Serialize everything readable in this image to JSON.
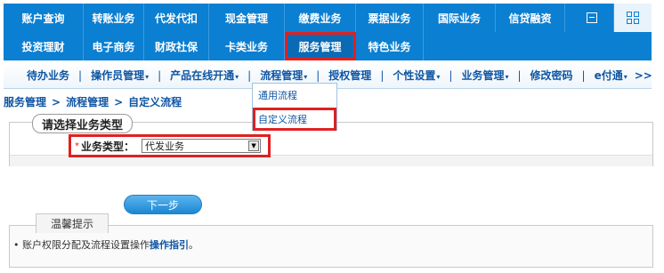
{
  "topnav": {
    "row1": [
      "账户查询",
      "转账业务",
      "代发代扣",
      "现金管理",
      "缴费业务",
      "票据业务",
      "国际业务",
      "信贷融资"
    ],
    "row2": [
      "投资理财",
      "电子商务",
      "财政社保",
      "卡类业务",
      "服务管理",
      "特色业务"
    ],
    "active": "服务管理"
  },
  "icons": {
    "collapse": "collapse-icon",
    "apps": "grid-icon",
    "dropdown_caret": "caret-down-icon"
  },
  "submenu": {
    "items": [
      "待办业务",
      "操作员管理",
      "产品在线开通",
      "流程管理",
      "授权管理",
      "个性设置",
      "业务管理",
      "修改密码",
      "e付通"
    ],
    "separator": "|",
    "caret": "▾",
    "more": ">>"
  },
  "dropdown": {
    "options": [
      "通用流程",
      "自定义流程"
    ],
    "highlighted": "自定义流程"
  },
  "breadcrumb": {
    "parts": [
      "服务管理",
      "流程管理",
      "自定义流程"
    ],
    "sep": ">"
  },
  "form": {
    "section_title": "请选择业务类型",
    "required_mark": "*",
    "business_type_label": "业务类型：",
    "business_type_value": "代发业务"
  },
  "next_button": "下一步",
  "tips": {
    "title": "温馨提示",
    "bullet": "•",
    "text": "账户权限分配及流程设置操作",
    "link": "操作指引",
    "end": "。"
  },
  "colors": {
    "nav_blue": "#0b7fd1",
    "link_blue": "#0f56a3",
    "highlight_red": "#e02020"
  }
}
